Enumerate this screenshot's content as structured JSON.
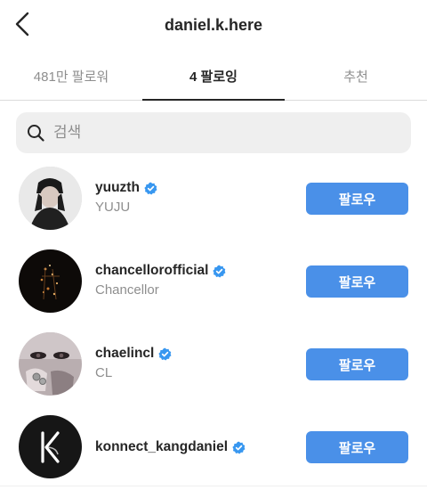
{
  "header": {
    "title": "daniel.k.here",
    "back_icon": "chevron-left-icon"
  },
  "tabs": [
    {
      "label": "481만 팔로워",
      "active": false
    },
    {
      "label": "4 팔로잉",
      "active": true
    },
    {
      "label": "추천",
      "active": false
    }
  ],
  "search": {
    "placeholder": "검색",
    "value": "",
    "icon": "search-icon"
  },
  "users": [
    {
      "username": "yuuzth",
      "fullname": "YUJU",
      "verified": true,
      "button": "팔로우"
    },
    {
      "username": "chancellorofficial",
      "fullname": "Chancellor",
      "verified": true,
      "button": "팔로우"
    },
    {
      "username": "chaelincl",
      "fullname": "CL",
      "verified": true,
      "button": "팔로우"
    },
    {
      "username": "konnect_kangdaniel",
      "fullname": "",
      "verified": true,
      "button": "팔로우"
    }
  ],
  "colors": {
    "accent": "#4a90e8",
    "verified": "#3897f0",
    "text": "#262626",
    "muted": "#8e8e8e"
  }
}
